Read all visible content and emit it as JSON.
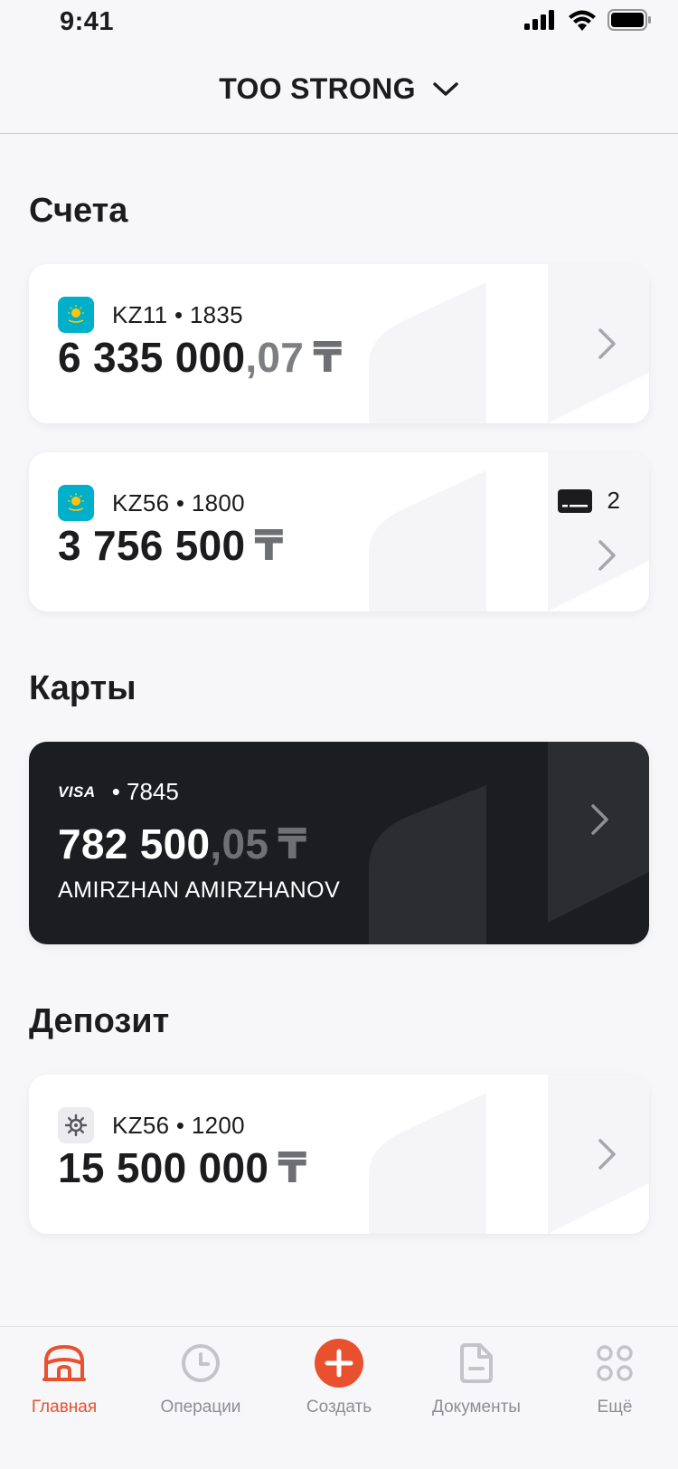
{
  "status_bar": {
    "time": "9:41"
  },
  "header": {
    "org_name": "TOO STRONG"
  },
  "sections": {
    "accounts_title": "Счета",
    "cards_title": "Карты",
    "deposit_title": "Депозит"
  },
  "accounts": [
    {
      "prefix": "KZ11",
      "suffix": "1835",
      "amount_int": "6 335 000",
      "amount_frac": ",07",
      "currency": "₸"
    },
    {
      "prefix": "KZ56",
      "suffix": "1800",
      "amount_int": "3 756 500",
      "amount_frac": "",
      "currency": "₸",
      "cards_count": "2"
    }
  ],
  "cards": [
    {
      "brand": "VISA",
      "suffix": "7845",
      "amount_int": "782 500",
      "amount_frac": ",05",
      "currency": "₸",
      "holder": "AMIRZHAN AMIRZHANOV"
    }
  ],
  "deposits": [
    {
      "prefix": "KZ56",
      "suffix": "1200",
      "amount_int": "15 500 000",
      "amount_frac": "",
      "currency": "₸"
    }
  ],
  "tabs": [
    {
      "label": "Главная",
      "icon": "home-icon",
      "active": true
    },
    {
      "label": "Операции",
      "icon": "clock-icon"
    },
    {
      "label": "Создать",
      "icon": "plus-icon"
    },
    {
      "label": "Документы",
      "icon": "document-icon"
    },
    {
      "label": "Ещё",
      "icon": "more-icon"
    }
  ],
  "colors": {
    "accent": "#e8502e",
    "flag": "#00afca",
    "dark_card": "#1c1d21",
    "background": "#f7f7f9"
  }
}
